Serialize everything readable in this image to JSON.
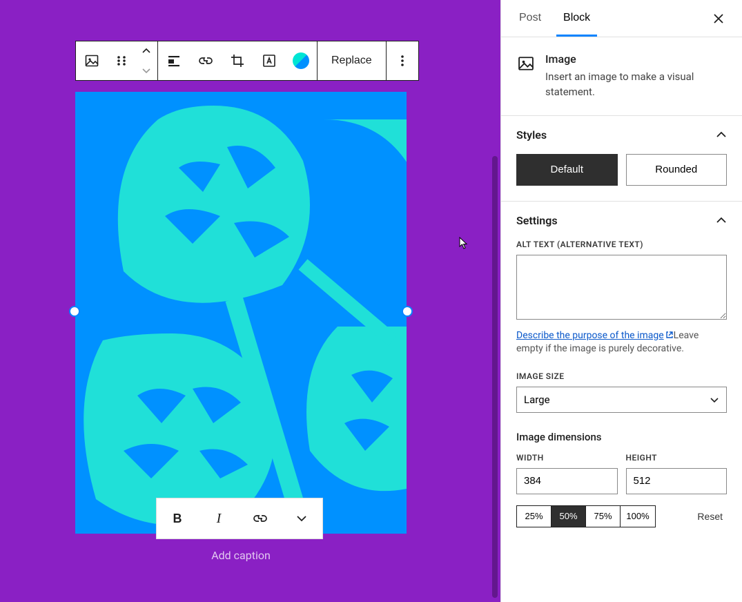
{
  "toolbar": {
    "replace_label": "Replace"
  },
  "format_bar": {
    "bold": "B",
    "italic": "I"
  },
  "caption_placeholder": "Add caption",
  "sidebar": {
    "tabs": {
      "post": "Post",
      "block": "Block"
    },
    "block": {
      "title": "Image",
      "description": "Insert an image to make a visual statement."
    },
    "styles": {
      "heading": "Styles",
      "default": "Default",
      "rounded": "Rounded"
    },
    "settings": {
      "heading": "Settings",
      "alt_label": "ALT TEXT (ALTERNATIVE TEXT)",
      "alt_value": "",
      "helper_link": "Describe the purpose of the image",
      "helper_suffix": "Leave empty if the image is purely decorative.",
      "image_size_label": "IMAGE SIZE",
      "image_size_value": "Large",
      "dimensions_label": "Image dimensions",
      "width_label": "WIDTH",
      "height_label": "HEIGHT",
      "width_value": "384",
      "height_value": "512",
      "pct": {
        "p25": "25%",
        "p50": "50%",
        "p75": "75%",
        "p100": "100%"
      },
      "reset": "Reset"
    }
  }
}
